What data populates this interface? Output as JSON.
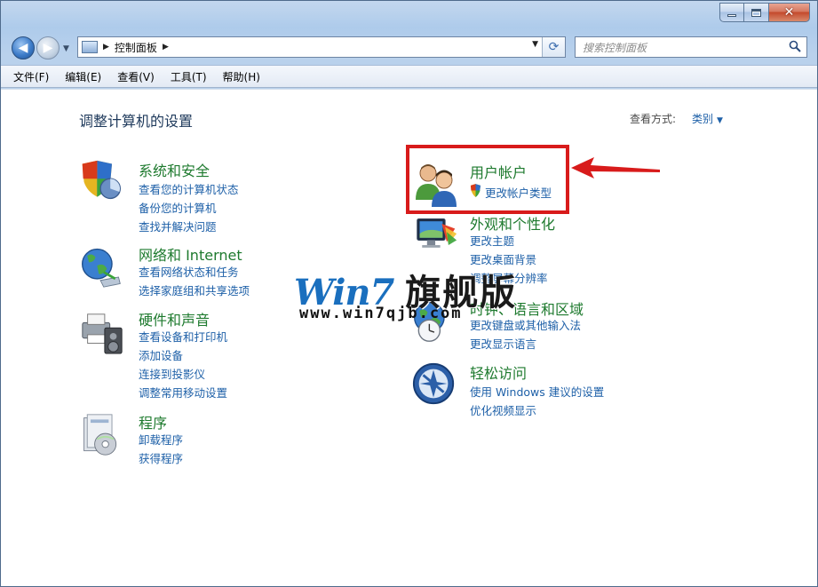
{
  "window": {
    "caption_buttons": {
      "minimize": "minimize-icon",
      "maximize": "maximize-icon",
      "close": "close-icon"
    }
  },
  "nav": {
    "back_icon": "back-arrow-icon",
    "forward_icon": "forward-arrow-icon",
    "breadcrumb": "控制面板",
    "search_placeholder": "搜索控制面板"
  },
  "menu": [
    "文件(F)",
    "编辑(E)",
    "查看(V)",
    "工具(T)",
    "帮助(H)"
  ],
  "main": {
    "title": "调整计算机的设置",
    "view_by_label": "查看方式:",
    "view_by_value": "类别"
  },
  "categories": {
    "system": {
      "title": "系统和安全",
      "links": [
        "查看您的计算机状态",
        "备份您的计算机",
        "查找并解决问题"
      ]
    },
    "network": {
      "title": "网络和 Internet",
      "links": [
        "查看网络状态和任务",
        "选择家庭组和共享选项"
      ]
    },
    "hardware": {
      "title": "硬件和声音",
      "links": [
        "查看设备和打印机",
        "添加设备",
        "连接到投影仪",
        "调整常用移动设置"
      ]
    },
    "programs": {
      "title": "程序",
      "links": [
        "卸载程序",
        "获得程序"
      ]
    },
    "users": {
      "title": "用户帐户",
      "links": [
        "更改帐户类型"
      ]
    },
    "appearance": {
      "title": "外观和个性化",
      "links": [
        "更改主题",
        "更改桌面背景",
        "调整屏幕分辨率"
      ]
    },
    "clock": {
      "title": "时钟、语言和区域",
      "links": [
        "更改键盘或其他输入法",
        "更改显示语言"
      ]
    },
    "access": {
      "title": "轻松访问",
      "links": [
        "使用 Windows 建议的设置",
        "优化视频显示"
      ]
    }
  },
  "watermark": {
    "brand": "Win7",
    "brand_cn": "旗舰版",
    "url": "www.win7qjb.com"
  },
  "colors": {
    "category_title": "#1e7a2e",
    "link": "#1e60a8",
    "highlight": "#d81b1b"
  }
}
